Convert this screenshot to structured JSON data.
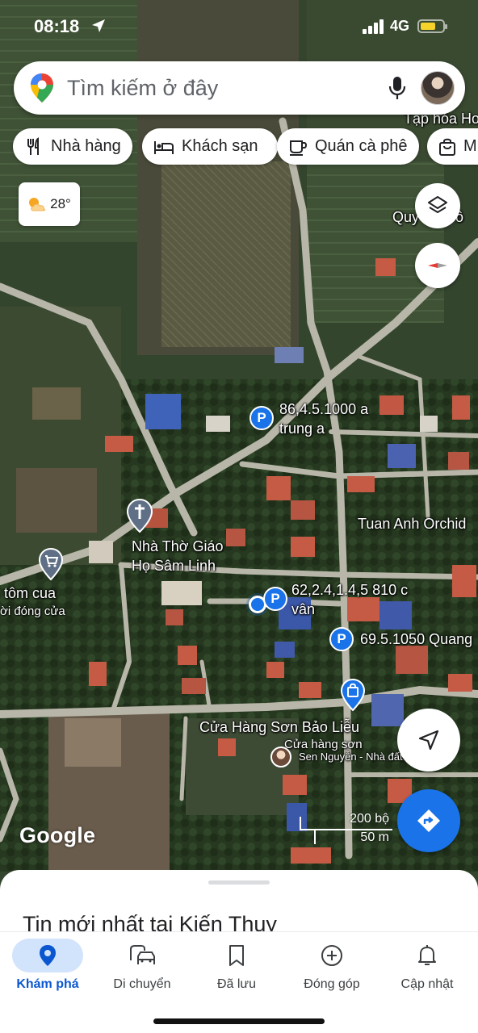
{
  "status_bar": {
    "time": "08:18",
    "network": "4G"
  },
  "search": {
    "placeholder": "Tìm kiếm ở đây"
  },
  "chips": [
    {
      "label": "Nhà hàng",
      "icon": "fork-knife-icon"
    },
    {
      "label": "Khách sạn",
      "icon": "bed-icon"
    },
    {
      "label": "Quán cà phê",
      "icon": "coffee-icon"
    },
    {
      "label": "M",
      "icon": "shopping-bag-icon"
    }
  ],
  "weather": {
    "temp": "28°",
    "icon": "partly-cloudy-icon"
  },
  "map_labels": {
    "tap_hoa": "Tạp hóa Ho",
    "quy": "Quy",
    "quy_end": "ô",
    "parking1_line1": "86,4.5.1000 a",
    "parking1_line2": "trung a",
    "tuan_anh": "Tuan Anh Orchid",
    "church_line1": "Nhà Thờ Giáo",
    "church_line2": "Họ Sâm Linh",
    "parking2_line1": "62,2.4,1.4,5 810 c",
    "parking2_line2": "vân",
    "parking3": "69.5.1050 Quang",
    "tom_cua": "tôm cua",
    "closed": "ời đóng cửa",
    "shop": "Cửa Hàng Sơn Bảo Liễu",
    "shop_sub": "Cửa hàng sơn",
    "sen": "Sen Nguyễn - Nhà đất Anh Minh"
  },
  "logo": "Google",
  "scale": {
    "ft": "200 bộ",
    "m": "50 m"
  },
  "sheet": {
    "title": "Tin mới nhất tại Kiến Thuy"
  },
  "nav": [
    {
      "label": "Khám phá",
      "icon": "explore-pin-icon",
      "active": true
    },
    {
      "label": "Di chuyển",
      "icon": "commute-car-icon",
      "active": false
    },
    {
      "label": "Đã lưu",
      "icon": "bookmark-icon",
      "active": false
    },
    {
      "label": "Đóng góp",
      "icon": "add-circle-icon",
      "active": false
    },
    {
      "label": "Cập nhật",
      "icon": "bell-icon",
      "active": false
    }
  ],
  "colors": {
    "accent": "#1a73e8",
    "active_nav": "#0b57d0",
    "nav_pill": "#d2e3fc"
  }
}
